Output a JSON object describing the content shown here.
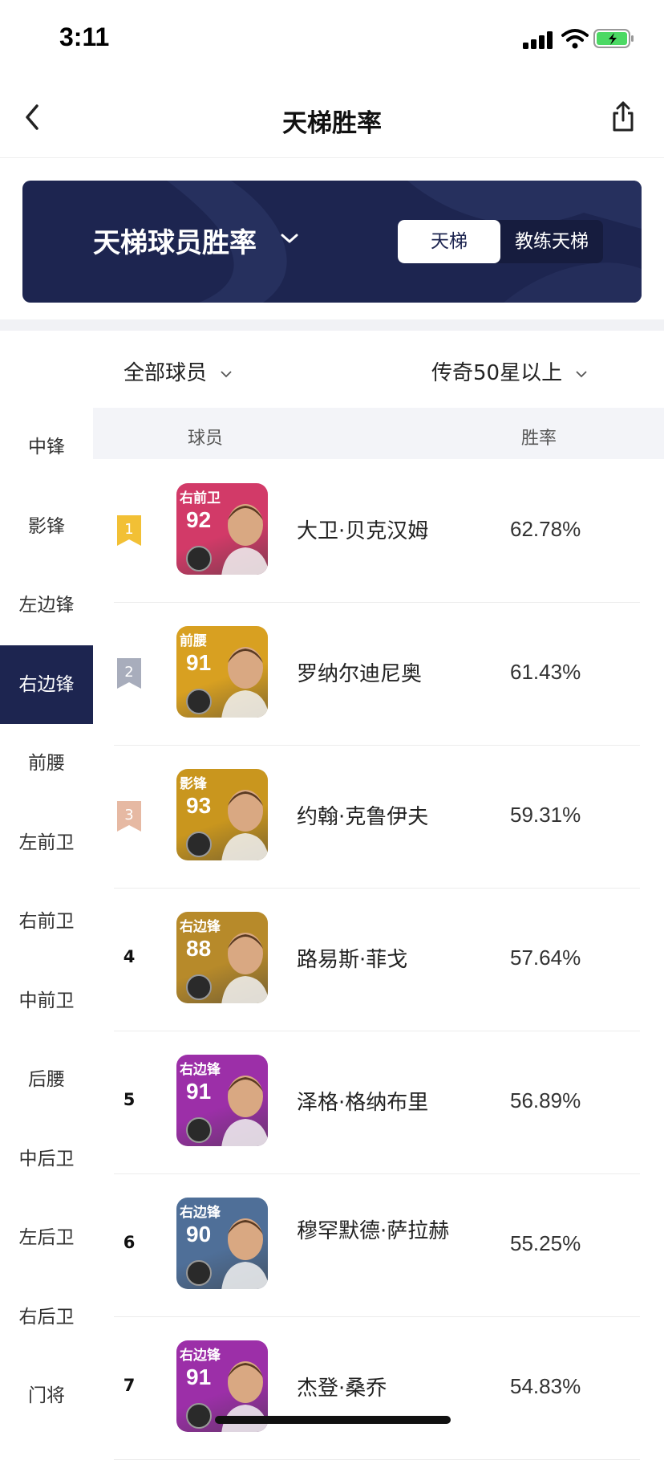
{
  "status": {
    "time": "3:11"
  },
  "nav": {
    "title": "天梯胜率"
  },
  "banner": {
    "title": "天梯球员胜率",
    "tabs": [
      "天梯",
      "教练天梯"
    ],
    "active_tab": 0
  },
  "filters": {
    "players": "全部球员",
    "level": "传奇50星以上"
  },
  "table": {
    "col_player": "球员",
    "col_rate": "胜率"
  },
  "sidebar": {
    "items": [
      "中锋",
      "影锋",
      "左边锋",
      "右边锋",
      "前腰",
      "左前卫",
      "右前卫",
      "中前卫",
      "后腰",
      "中后卫",
      "左后卫",
      "右后卫",
      "门将"
    ],
    "active_index": 3
  },
  "rows": [
    {
      "rank": "1",
      "pos": "右前卫",
      "rating": "92",
      "name": "大卫·贝克汉姆",
      "rate": "62.78%",
      "card_color": "#d23a68"
    },
    {
      "rank": "2",
      "pos": "前腰",
      "rating": "91",
      "name": "罗纳尔迪尼奥",
      "rate": "61.43%",
      "card_color": "#d8a021"
    },
    {
      "rank": "3",
      "pos": "影锋",
      "rating": "93",
      "name": "约翰·克鲁伊夫",
      "rate": "59.31%",
      "card_color": "#c9961e"
    },
    {
      "rank": "4",
      "pos": "右边锋",
      "rating": "88",
      "name": "路易斯·菲戈",
      "rate": "57.64%",
      "card_color": "#b78a2a"
    },
    {
      "rank": "5",
      "pos": "右边锋",
      "rating": "91",
      "name": "泽格·格纳布里",
      "rate": "56.89%",
      "card_color": "#9c2fa8"
    },
    {
      "rank": "6",
      "pos": "右边锋",
      "rating": "90",
      "name": "穆罕默德·萨拉赫",
      "rate": "55.25%",
      "card_color": "#4f6f98"
    },
    {
      "rank": "7",
      "pos": "右边锋",
      "rating": "91",
      "name": "杰登·桑乔",
      "rate": "54.83%",
      "card_color": "#9c2fa8"
    }
  ],
  "colors": {
    "navy": "#1d2550",
    "gold": "#f2c035",
    "silver": "#a8adbc",
    "bronze": "#e6b9a3"
  }
}
